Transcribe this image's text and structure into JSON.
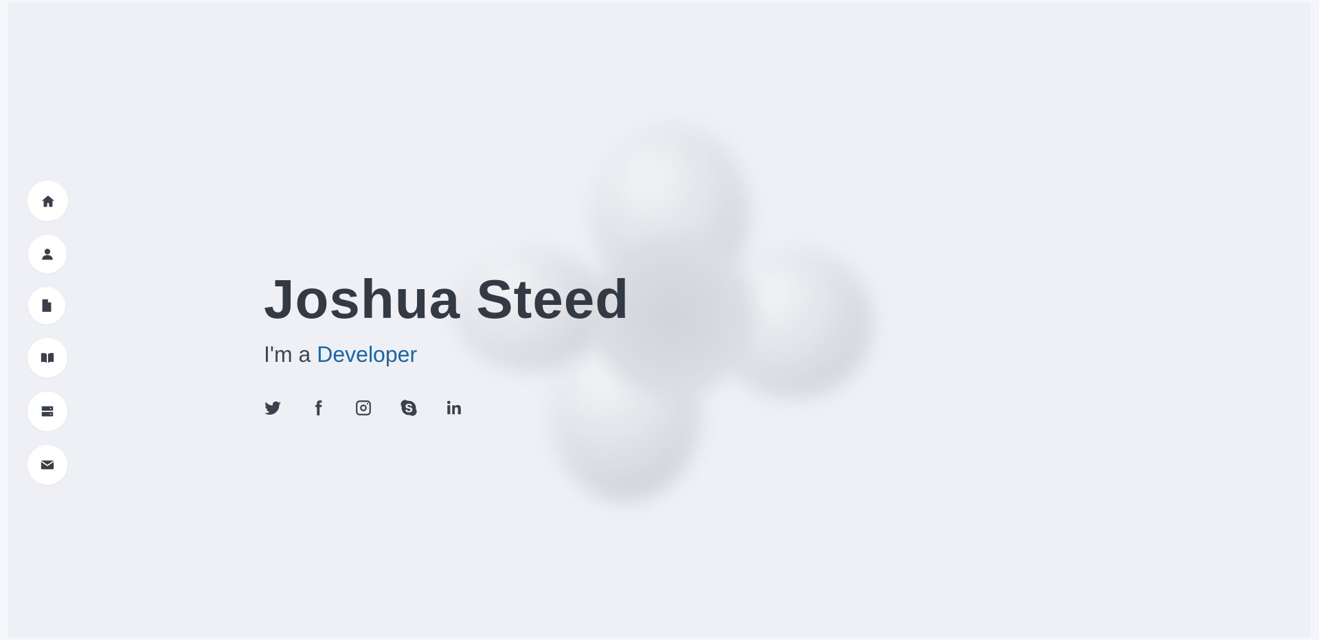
{
  "hero": {
    "name": "Joshua Steed",
    "subtitle_prefix": "I'm a",
    "subtitle_role": "Developer"
  },
  "side_nav": [
    {
      "icon": "home-icon"
    },
    {
      "icon": "user-icon"
    },
    {
      "icon": "file-icon"
    },
    {
      "icon": "book-icon"
    },
    {
      "icon": "server-icon"
    },
    {
      "icon": "envelope-icon"
    }
  ],
  "social_links": [
    {
      "icon": "twitter-icon"
    },
    {
      "icon": "facebook-icon"
    },
    {
      "icon": "instagram-icon"
    },
    {
      "icon": "skype-icon"
    },
    {
      "icon": "linkedin-icon"
    }
  ],
  "colors": {
    "background": "#eef0f5",
    "text": "#343a44",
    "accent": "#1a65a8"
  }
}
